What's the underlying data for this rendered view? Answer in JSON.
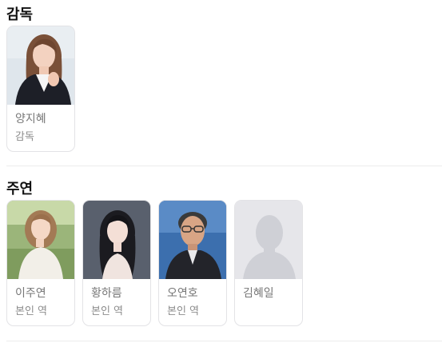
{
  "sections": [
    {
      "title": "감독",
      "people": [
        {
          "name": "양지혜",
          "role": "감독",
          "photo_icon": "person-photo"
        }
      ]
    },
    {
      "title": "주연",
      "people": [
        {
          "name": "이주연",
          "role": "본인 역",
          "photo_icon": "person-photo"
        },
        {
          "name": "황하름",
          "role": "본인 역",
          "photo_icon": "person-photo"
        },
        {
          "name": "오연호",
          "role": "본인 역",
          "photo_icon": "person-photo"
        },
        {
          "name": "김혜일",
          "role": "",
          "photo_icon": "default-avatar-icon"
        }
      ]
    }
  ],
  "colors": {
    "card_border": "#e3e3e6",
    "name_text": "#777777",
    "role_text": "#8c8c8c",
    "placeholder_bg": "#e6e6ea",
    "placeholder_silhouette": "#cfd0d6"
  }
}
